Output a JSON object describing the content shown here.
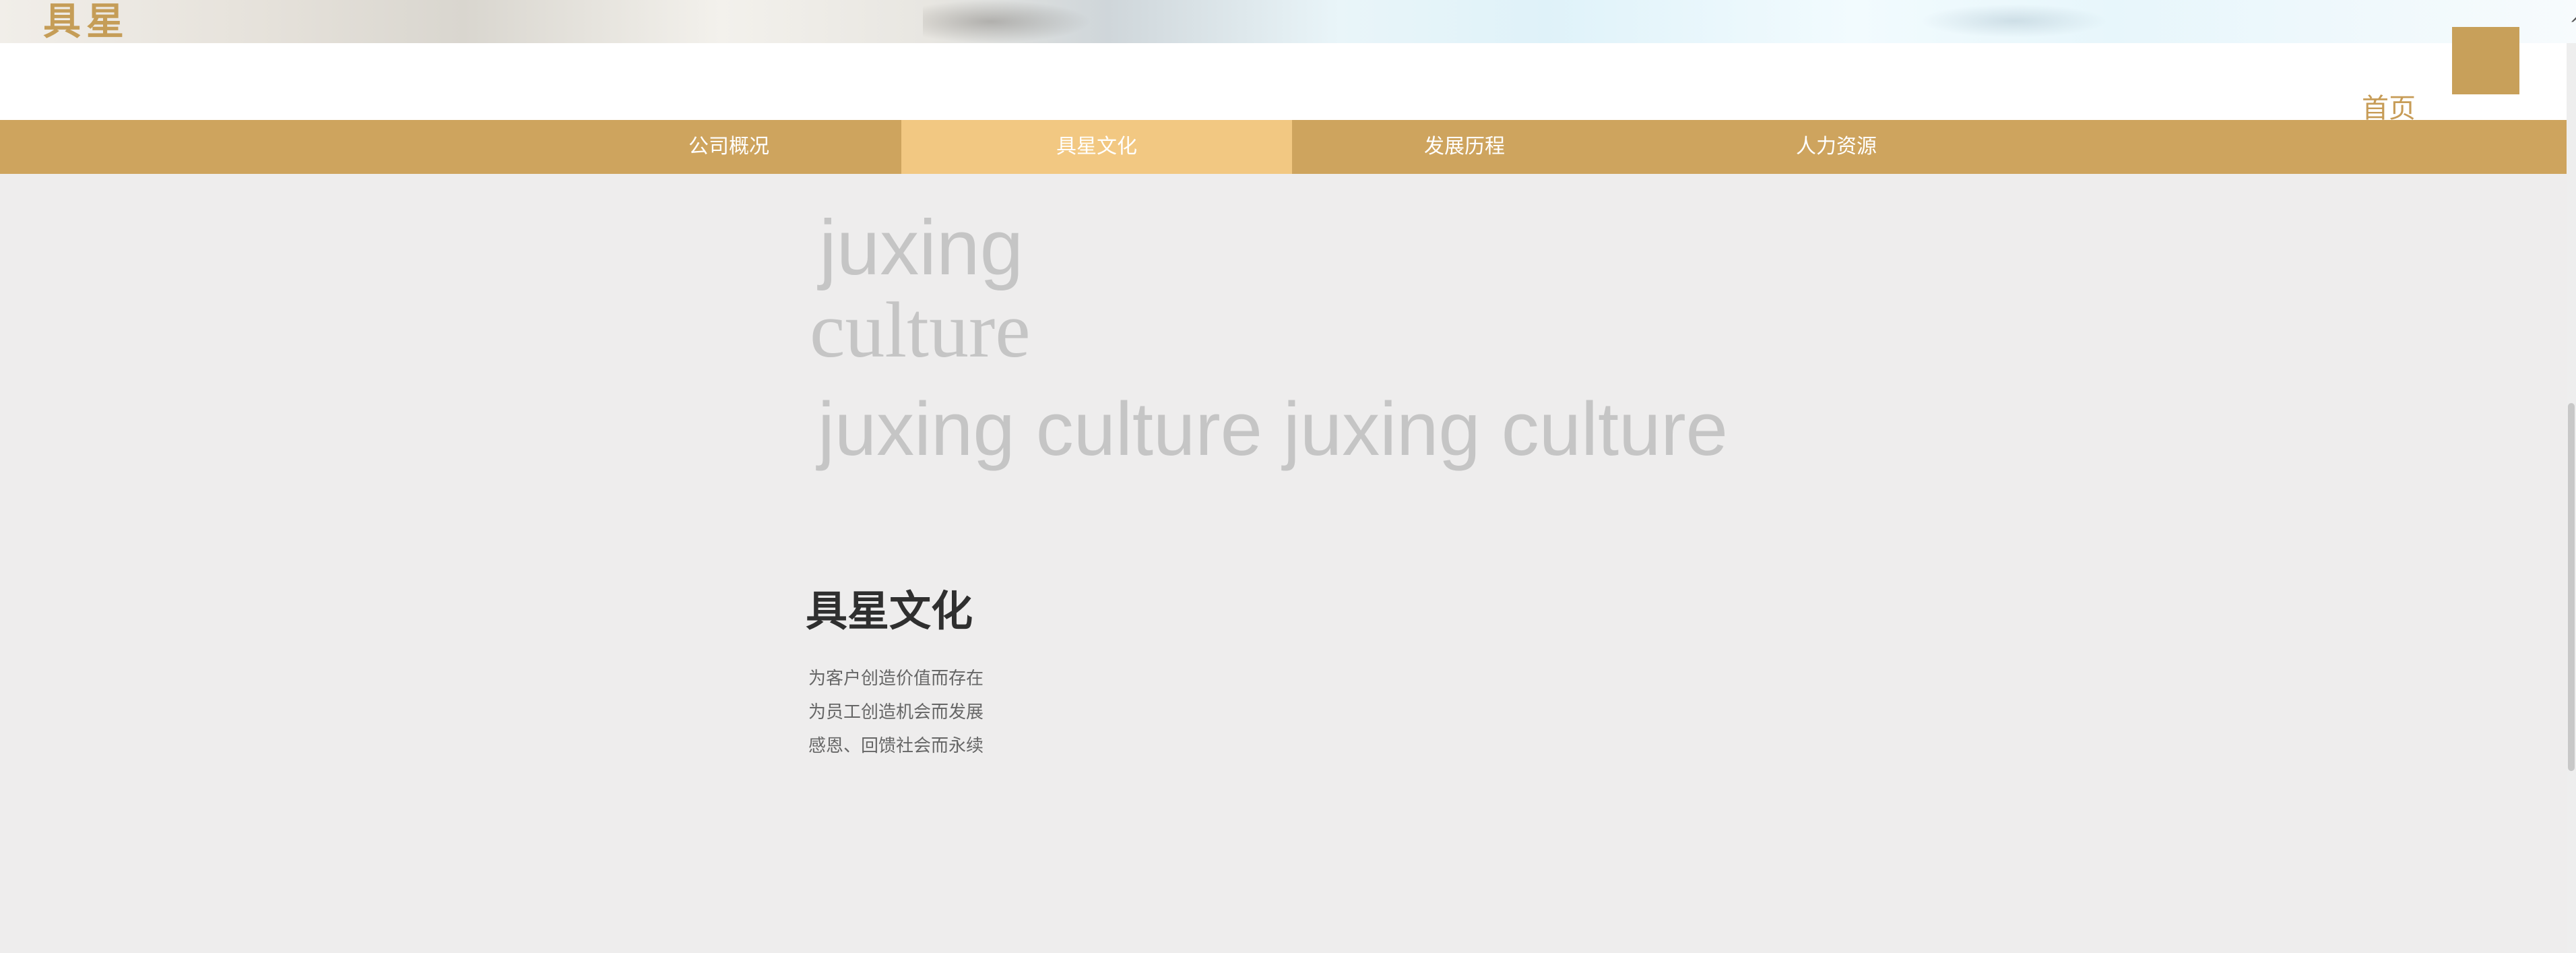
{
  "header": {
    "logo_text": "具星",
    "home_label": "首页"
  },
  "nav": {
    "items": [
      {
        "label": "公司概况"
      },
      {
        "label": "具星文化",
        "active": true
      },
      {
        "label": "发展历程"
      },
      {
        "label": "人力资源"
      }
    ]
  },
  "decor": {
    "line1": "juxing",
    "line2": "culture",
    "line3": "juxing culture  juxing culture"
  },
  "main": {
    "title": "具星文化",
    "lines": [
      "为客户创造价值而存在",
      "为员工创造机会而发展",
      "感恩、回馈社会而永续"
    ]
  },
  "colors": {
    "brand_gold": "#c59d57",
    "nav_bar": "#cea45e",
    "nav_active": "#f2c882",
    "page_bg": "#eeeded"
  },
  "icons": {
    "menu": "menu-square-icon",
    "scroll_up": "chevron-up-icon"
  }
}
